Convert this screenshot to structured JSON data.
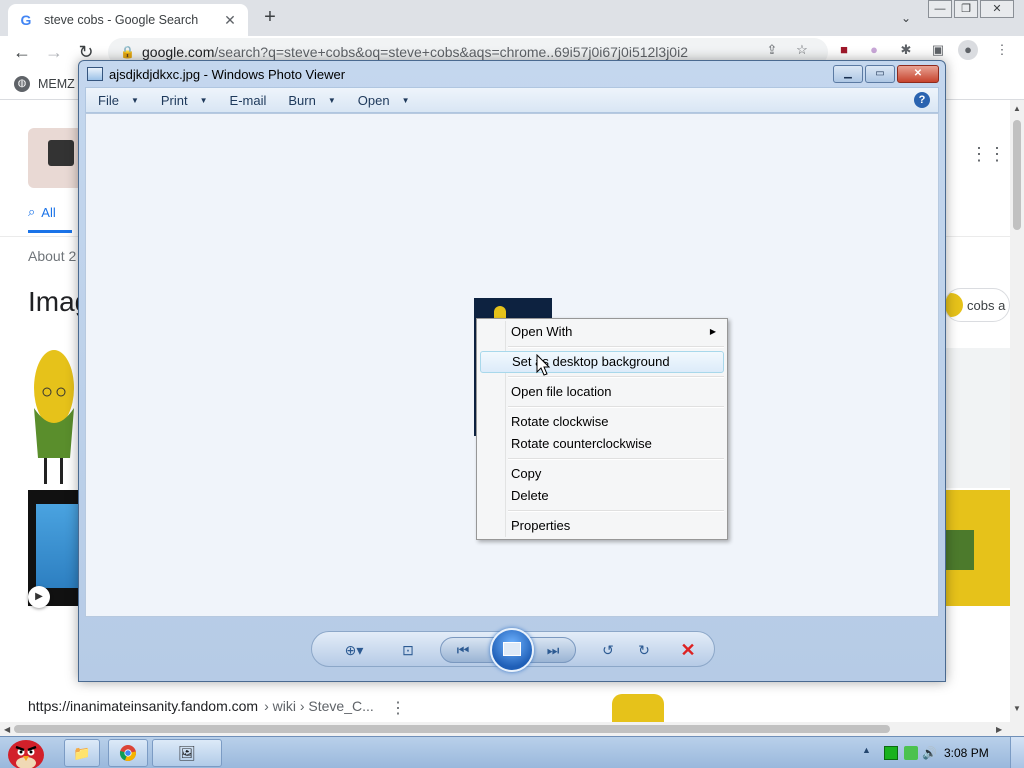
{
  "chrome": {
    "tab_title": "steve cobs - Google Search",
    "tab_icon": "G",
    "url_domain": "google.com",
    "url_path": "/search?q=steve+cobs&oq=steve+cobs&aqs=chrome..69i57j0i67j0i512l3j0i2",
    "bookmark_label": "MEMZ"
  },
  "google": {
    "tab_all_label": "All",
    "about_text": "About 2",
    "images_heading": "Imag",
    "chip_label": "cobs a",
    "result_url": "https://inanimateinsanity.fandom.com",
    "result_crumbs": "› wiki › Steve_C..."
  },
  "photo_viewer": {
    "title": "ajsdjkdjdkxc.jpg - Windows Photo Viewer",
    "menu": [
      {
        "label": "File"
      },
      {
        "label": "Print"
      },
      {
        "label": "E-mail"
      },
      {
        "label": "Burn"
      },
      {
        "label": "Open"
      }
    ],
    "help_glyph": "?"
  },
  "context_menu": {
    "items": [
      {
        "label": "Open With",
        "has_submenu": true
      },
      {
        "label": "Set as desktop background",
        "highlighted": true
      },
      {
        "label": "Open file location"
      },
      {
        "label": "Rotate clockwise"
      },
      {
        "label": "Rotate counterclockwise"
      },
      {
        "label": "Copy"
      },
      {
        "label": "Delete"
      },
      {
        "label": "Properties"
      }
    ]
  },
  "taskbar": {
    "clock": "3:08 PM"
  },
  "colors": {
    "accent_blue": "#1a73e8",
    "viewer_frame": "#c4d7ee",
    "taskbar": "#b9d0ea"
  }
}
